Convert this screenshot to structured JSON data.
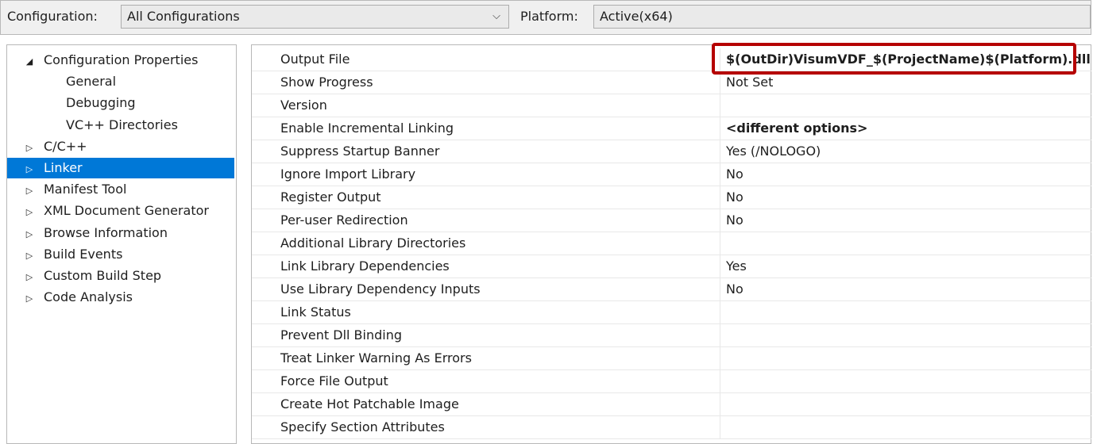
{
  "toolbar": {
    "configuration_label": "Configuration:",
    "configuration_value": "All Configurations",
    "platform_label": "Platform:",
    "platform_value": "Active(x64)",
    "dropdown_icon": "chevron-down-icon"
  },
  "tree": {
    "items": [
      {
        "label": "Configuration Properties",
        "expander": "◢"
      },
      {
        "label": "General",
        "expander": ""
      },
      {
        "label": "Debugging",
        "expander": ""
      },
      {
        "label": "VC++ Directories",
        "expander": ""
      },
      {
        "label": "C/C++",
        "expander": "▷"
      },
      {
        "label": "Linker",
        "expander": "▷",
        "selected": true
      },
      {
        "label": "Manifest Tool",
        "expander": "▷"
      },
      {
        "label": "XML Document Generator",
        "expander": "▷"
      },
      {
        "label": "Browse Information",
        "expander": "▷"
      },
      {
        "label": "Build Events",
        "expander": "▷"
      },
      {
        "label": "Custom Build Step",
        "expander": "▷"
      },
      {
        "label": "Code Analysis",
        "expander": "▷"
      }
    ]
  },
  "properties": [
    {
      "name": "Output File",
      "value": "$(OutDir)VisumVDF_$(ProjectName)$(Platform).dll",
      "bold": true
    },
    {
      "name": "Show Progress",
      "value": "Not Set"
    },
    {
      "name": "Version",
      "value": ""
    },
    {
      "name": "Enable Incremental Linking",
      "value": "<different options>",
      "bold": true
    },
    {
      "name": "Suppress Startup Banner",
      "value": "Yes (/NOLOGO)"
    },
    {
      "name": "Ignore Import Library",
      "value": "No"
    },
    {
      "name": "Register Output",
      "value": "No"
    },
    {
      "name": "Per-user Redirection",
      "value": "No"
    },
    {
      "name": "Additional Library Directories",
      "value": ""
    },
    {
      "name": "Link Library Dependencies",
      "value": "Yes"
    },
    {
      "name": "Use Library Dependency Inputs",
      "value": "No"
    },
    {
      "name": "Link Status",
      "value": ""
    },
    {
      "name": "Prevent Dll Binding",
      "value": ""
    },
    {
      "name": "Treat Linker Warning As Errors",
      "value": ""
    },
    {
      "name": "Force File Output",
      "value": ""
    },
    {
      "name": "Create Hot Patchable Image",
      "value": ""
    },
    {
      "name": "Specify Section Attributes",
      "value": ""
    }
  ],
  "colors": {
    "selection": "#0078d7",
    "highlight_border": "#b50000"
  }
}
